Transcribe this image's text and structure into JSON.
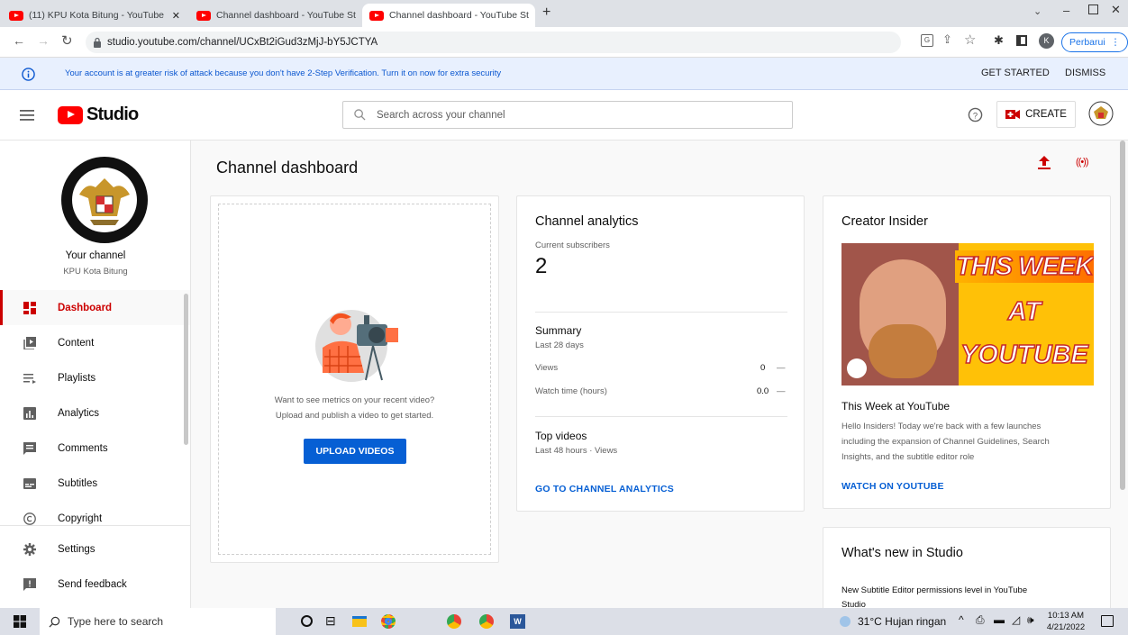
{
  "browser": {
    "tabs": [
      {
        "title": "(11) KPU Kota Bitung - YouTube"
      },
      {
        "title": "Channel dashboard - YouTube St"
      },
      {
        "title": "Channel dashboard - YouTube St"
      }
    ],
    "url": "studio.youtube.com/channel/UCxBt2iGud3zMjJ-bY5JCTYA",
    "profile_initial": "K",
    "update_label": "Perbarui"
  },
  "banner": {
    "message": "Your account is at greater risk of attack because you don't have 2-Step Verification. Turn it on now for extra security",
    "get_started": "GET STARTED",
    "dismiss": "DISMISS"
  },
  "header": {
    "logo_text": "Studio",
    "search_placeholder": "Search across your channel",
    "create_label": "CREATE"
  },
  "sidebar": {
    "channel_label": "Your channel",
    "channel_name": "KPU Kota Bitung",
    "items": [
      {
        "label": "Dashboard"
      },
      {
        "label": "Content"
      },
      {
        "label": "Playlists"
      },
      {
        "label": "Analytics"
      },
      {
        "label": "Comments"
      },
      {
        "label": "Subtitles"
      },
      {
        "label": "Copyright"
      },
      {
        "label": "Settings"
      },
      {
        "label": "Send feedback"
      }
    ]
  },
  "main": {
    "page_title": "Channel dashboard",
    "upload_card": {
      "message_line1": "Want to see metrics on your recent video?",
      "message_line2": "Upload and publish a video to get started.",
      "button": "UPLOAD VIDEOS"
    },
    "analytics": {
      "title": "Channel analytics",
      "subscribers_label": "Current subscribers",
      "subscribers_value": "2",
      "summary_title": "Summary",
      "summary_period": "Last 28 days",
      "views_label": "Views",
      "views_value": "0",
      "views_trend": "—",
      "watch_label": "Watch time (hours)",
      "watch_value": "0.0",
      "watch_trend": "—",
      "top_title": "Top videos",
      "top_period": "Last 48 hours · Views",
      "link": "GO TO CHANNEL ANALYTICS"
    },
    "insider": {
      "title": "Creator Insider",
      "thumb_line1": "THIS WEEK",
      "thumb_line2": "AT",
      "thumb_line3": "YOUTUBE",
      "video_title": "This Week at YouTube",
      "desc_line1": "Hello Insiders! Today we're back with a few launches",
      "desc_line2": "including the expansion of Channel Guidelines, Search",
      "desc_line3": "Insights, and the subtitle editor role",
      "link": "WATCH ON YOUTUBE"
    },
    "whats_new": {
      "title": "What's new in Studio",
      "item_line1": "New Subtitle Editor permissions level in YouTube",
      "item_line2": "Studio"
    }
  },
  "taskbar": {
    "search_placeholder": "Type here to search",
    "weather": "31°C  Hujan ringan",
    "time": "10:13 AM",
    "date": "4/21/2022"
  },
  "colors": {
    "brand_red": "#ff0000",
    "link_blue": "#065fd4",
    "upload_blue": "#065fd4"
  }
}
